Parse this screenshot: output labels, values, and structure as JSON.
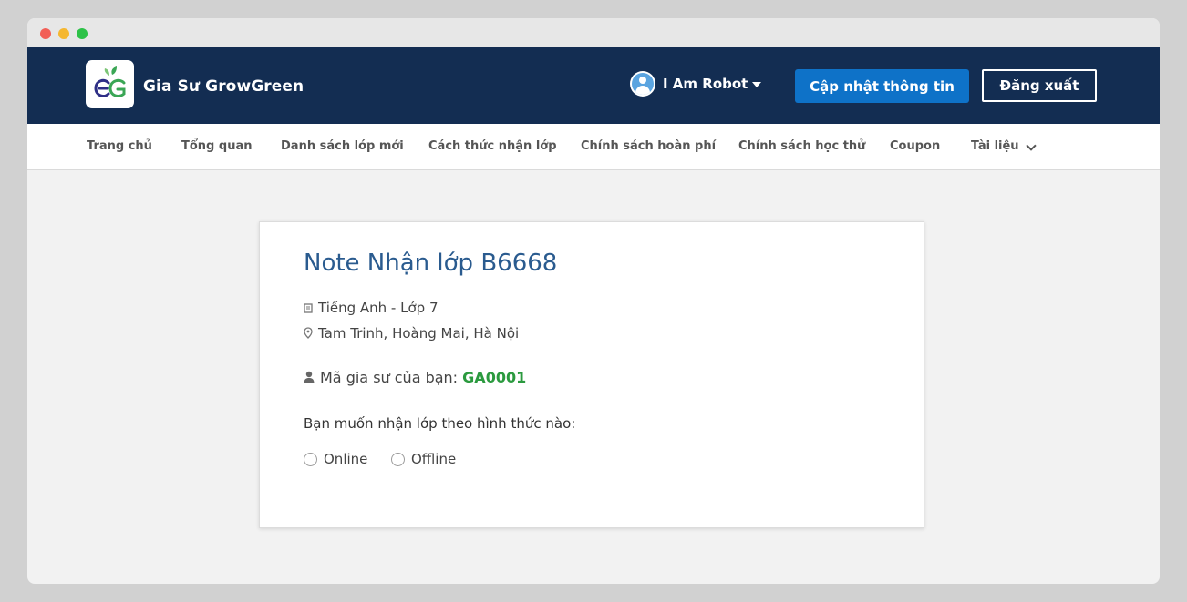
{
  "header": {
    "brand": "Gia Sư GrowGreen",
    "user_name": "I Am Robot",
    "update_button": "Cập nhật thông tin",
    "logout_button": "Đăng xuất"
  },
  "nav": {
    "items": [
      {
        "label": "Trang chủ"
      },
      {
        "label": "Tổng quan"
      },
      {
        "label": "Danh sách lớp mới"
      },
      {
        "label": "Cách thức nhận lớp"
      },
      {
        "label": "Chính sách hoàn phí"
      },
      {
        "label": "Chính sách học thử"
      },
      {
        "label": "Coupon"
      },
      {
        "label": "Tài liệu"
      }
    ]
  },
  "card": {
    "title": "Note Nhận lớp B6668",
    "subject": "Tiếng Anh - Lớp 7",
    "location": "Tam Trinh, Hoàng Mai, Hà Nội",
    "tutor_code_label": "Mã gia sư của bạn:",
    "tutor_code_value": "GA0001",
    "question": "Bạn muốn nhận lớp theo hình thức nào:",
    "options": [
      {
        "label": "Online"
      },
      {
        "label": "Offline"
      }
    ]
  },
  "colors": {
    "header_bg": "#132d52",
    "primary_button": "#0e72c8",
    "title": "#2a5b8f",
    "code": "#2b9a3f"
  }
}
